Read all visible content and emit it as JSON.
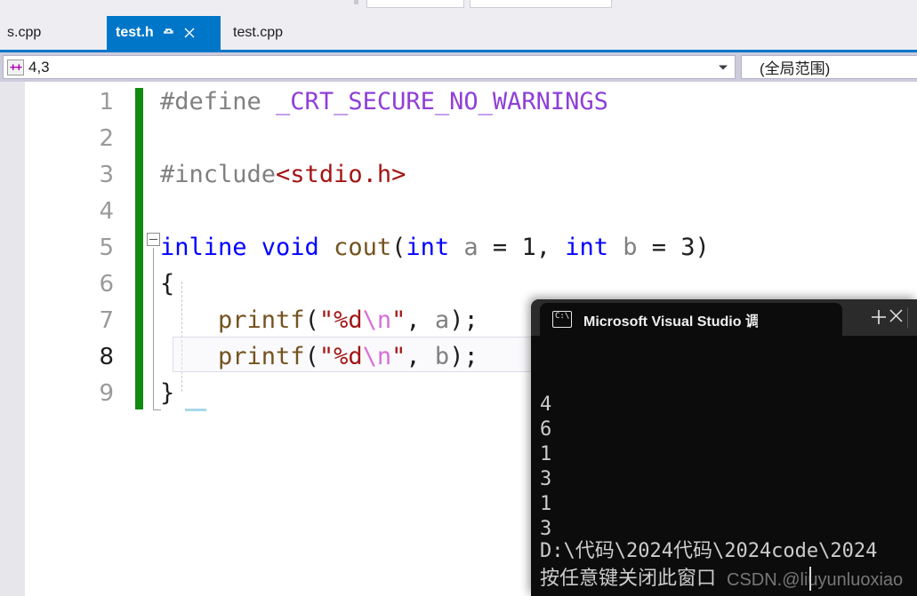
{
  "toolbar": {
    "combo1_label": "",
    "combo2_label": ""
  },
  "tabs": {
    "items": [
      {
        "label": "s.cpp",
        "active": false
      },
      {
        "label": "test.h",
        "active": true
      },
      {
        "label": "test.cpp",
        "active": false
      }
    ],
    "pin_icon": "pin-icon",
    "close_icon": "close-icon"
  },
  "navbar": {
    "member_icon": "cpp-members-icon",
    "member_value": "4,3",
    "scope_value": "(全局范围)",
    "dropdown_icon": "chevron-down-icon"
  },
  "editor": {
    "line_numbers": [
      "1",
      "2",
      "3",
      "4",
      "5",
      "6",
      "7",
      "8",
      "9"
    ],
    "current_line": "8",
    "lines": [
      {
        "n": "1",
        "tokens": [
          {
            "t": "#define ",
            "c": "k-pp"
          },
          {
            "t": "_CRT_SECURE_NO_WARNINGS",
            "c": "k-macro"
          }
        ]
      },
      {
        "n": "2",
        "tokens": []
      },
      {
        "n": "3",
        "tokens": [
          {
            "t": "#include",
            "c": "k-pp"
          },
          {
            "t": "<stdio.h>",
            "c": "k-hdr"
          }
        ]
      },
      {
        "n": "4",
        "tokens": []
      },
      {
        "n": "5",
        "tokens": [
          {
            "t": "inline void ",
            "c": "k-kw"
          },
          {
            "t": "cout",
            "c": "k-fn"
          },
          {
            "t": "(",
            "c": "k-plain"
          },
          {
            "t": "int ",
            "c": "k-kw"
          },
          {
            "t": "a ",
            "c": "k-var"
          },
          {
            "t": "= ",
            "c": "k-plain"
          },
          {
            "t": "1",
            "c": "k-plain"
          },
          {
            "t": ", ",
            "c": "k-plain"
          },
          {
            "t": "int ",
            "c": "k-kw"
          },
          {
            "t": "b ",
            "c": "k-var"
          },
          {
            "t": "= ",
            "c": "k-plain"
          },
          {
            "t": "3",
            "c": "k-plain"
          },
          {
            "t": ")",
            "c": "k-plain"
          }
        ]
      },
      {
        "n": "6",
        "tokens": [
          {
            "t": "{",
            "c": "k-plain"
          }
        ]
      },
      {
        "n": "7",
        "tokens": [
          {
            "t": "    ",
            "c": "k-plain"
          },
          {
            "t": "printf",
            "c": "k-fn"
          },
          {
            "t": "(",
            "c": "k-plain"
          },
          {
            "t": "\"%d",
            "c": "k-str"
          },
          {
            "t": "\\n",
            "c": "k-esc"
          },
          {
            "t": "\"",
            "c": "k-str"
          },
          {
            "t": ", ",
            "c": "k-plain"
          },
          {
            "t": "a",
            "c": "k-var"
          },
          {
            "t": ");",
            "c": "k-plain"
          }
        ]
      },
      {
        "n": "8",
        "tokens": [
          {
            "t": "    ",
            "c": "k-plain"
          },
          {
            "t": "printf",
            "c": "k-fn"
          },
          {
            "t": "(",
            "c": "k-plain"
          },
          {
            "t": "\"%d",
            "c": "k-str"
          },
          {
            "t": "\\n",
            "c": "k-esc"
          },
          {
            "t": "\"",
            "c": "k-str"
          },
          {
            "t": ", ",
            "c": "k-plain"
          },
          {
            "t": "b",
            "c": "k-var"
          },
          {
            "t": ");",
            "c": "k-plain"
          }
        ]
      },
      {
        "n": "9",
        "tokens": [
          {
            "t": "}",
            "c": "k-plain"
          }
        ]
      }
    ],
    "collapse_icon": "collapse-minus-icon",
    "change_bar_color": "#108b10"
  },
  "console": {
    "tab_icon": "cmd-prompt-icon",
    "tab_title": "Microsoft Visual Studio 调试控",
    "close_icon": "close-icon",
    "new_tab_icon": "plus-icon",
    "output_lines": [
      "4",
      "6",
      "1",
      "3",
      "1",
      "3"
    ],
    "path_line": "D:\\代码\\2024代码\\2024code\\2024",
    "prompt_line": "按任意键关闭此窗口",
    "watermark": "CSDN.@liuyunluoxiao"
  },
  "colors": {
    "accent": "#0076c9",
    "navbar": "#ccccdd",
    "toolbar": "#eeeef2",
    "console_bg": "#0c0c0c",
    "console_chrome": "#2b2b2b",
    "change_bar": "#108b10"
  }
}
